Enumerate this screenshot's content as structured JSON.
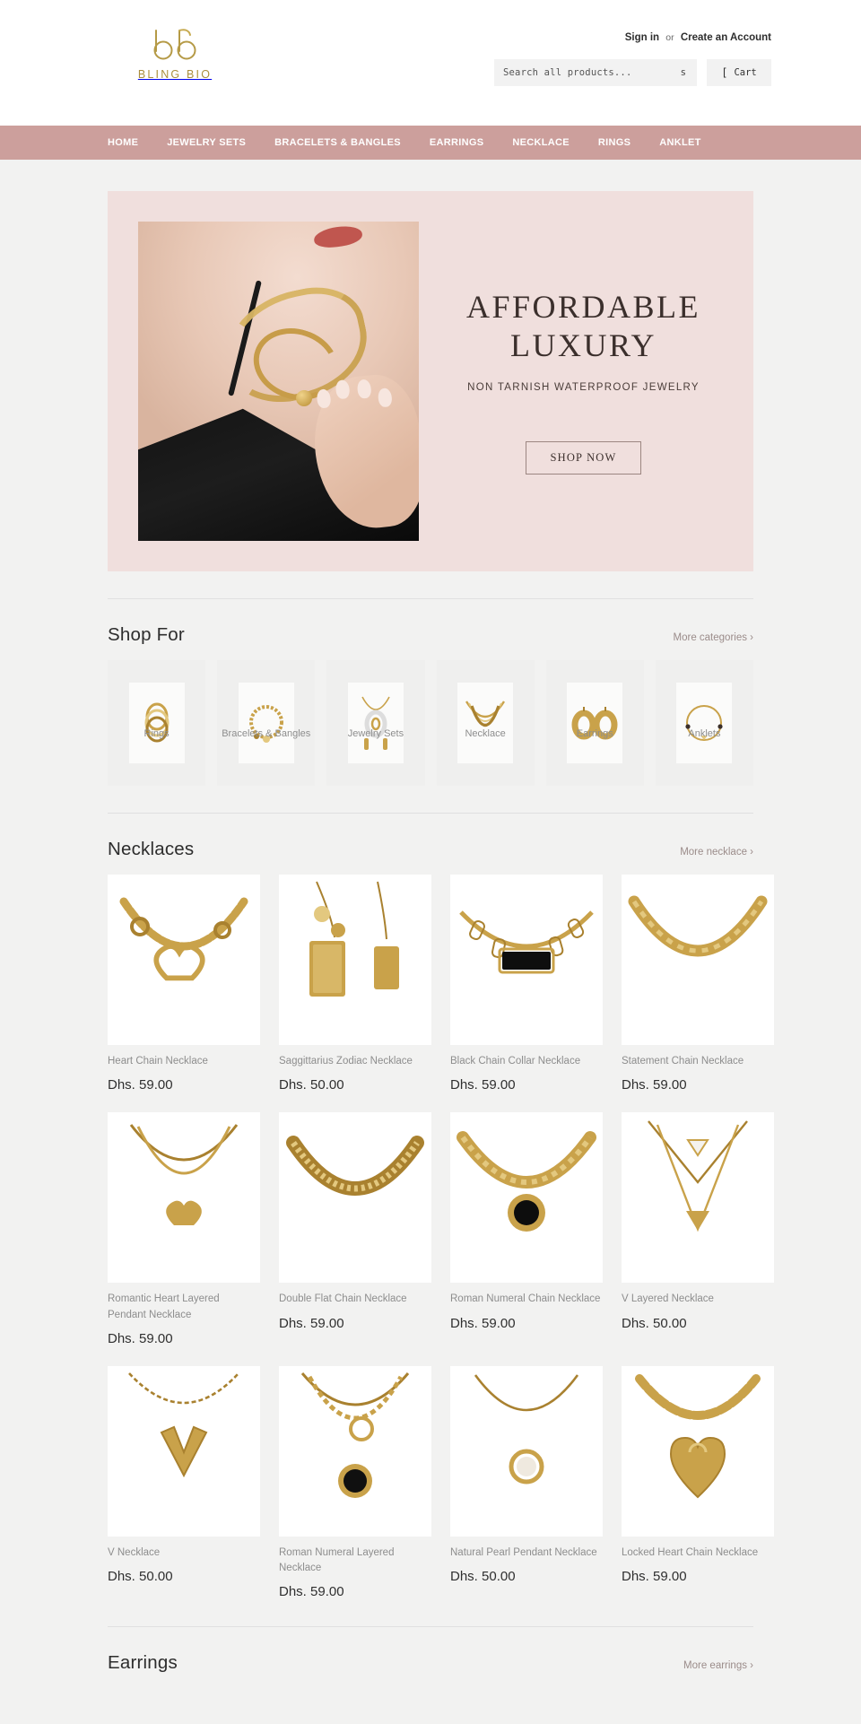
{
  "brand": {
    "name": "BLING BIO",
    "logo_mark": "bb-monogram",
    "logo_color": "#ab8f3e"
  },
  "header": {
    "sign_in": "Sign in",
    "or": "or",
    "create_account": "Create an Account",
    "search_placeholder": "Search all products...",
    "search_value": "",
    "search_submit_label": "s",
    "cart_label": "Cart",
    "cart_icon": "cart-icon"
  },
  "nav": {
    "background": "#cc9f9c",
    "items": [
      {
        "label": "HOME"
      },
      {
        "label": "JEWELRY SETS"
      },
      {
        "label": "BRACELETS & BANGLES"
      },
      {
        "label": "EARRINGS"
      },
      {
        "label": "NECKLACE"
      },
      {
        "label": "RINGS"
      },
      {
        "label": "ANKLET"
      }
    ]
  },
  "hero": {
    "background": "#f0dfdd",
    "title_line1": "AFFORDABLE",
    "title_line2": "LUXURY",
    "subtitle": "NON TARNISH WATERPROOF JEWELRY",
    "button": "SHOP NOW"
  },
  "shop_for": {
    "title": "Shop For",
    "more_label": "More categories ›",
    "categories": [
      {
        "label": "Rings",
        "icon": "rings-icon"
      },
      {
        "label": "Bracelets & Bangles",
        "icon": "bracelet-icon"
      },
      {
        "label": "Jewelry Sets",
        "icon": "jewelry-set-icon"
      },
      {
        "label": "Necklace",
        "icon": "necklace-icon"
      },
      {
        "label": "Earrings",
        "icon": "earrings-icon"
      },
      {
        "label": "Anklets",
        "icon": "anklet-icon"
      }
    ]
  },
  "necklaces": {
    "title": "Necklaces",
    "more_label": "More necklace ›",
    "products": [
      {
        "name": "Heart Chain Necklace",
        "price": "Dhs. 59.00",
        "style": "heart-toggle"
      },
      {
        "name": "Saggittarius Zodiac Necklace",
        "price": "Dhs. 50.00",
        "style": "zodiac-tags"
      },
      {
        "name": "Black Chain Collar Necklace",
        "price": "Dhs. 59.00",
        "style": "black-bar-collar"
      },
      {
        "name": "Statement Chain Necklace",
        "price": "Dhs. 59.00",
        "style": "statement-chain"
      },
      {
        "name": "Romantic Heart Layered Pendant Necklace",
        "price": "Dhs. 59.00",
        "style": "heart-layered"
      },
      {
        "name": "Double Flat Chain Necklace",
        "price": "Dhs. 59.00",
        "style": "flat-chain"
      },
      {
        "name": "Roman Numeral Chain Necklace",
        "price": "Dhs. 59.00",
        "style": "roman-disc"
      },
      {
        "name": "V Layered Necklace",
        "price": "Dhs. 50.00",
        "style": "v-layered"
      },
      {
        "name": "V Necklace",
        "price": "Dhs. 50.00",
        "style": "v-pendant"
      },
      {
        "name": "Roman Numeral Layered Necklace",
        "price": "Dhs. 59.00",
        "style": "roman-layered"
      },
      {
        "name": "Natural Pearl Pendant Necklace",
        "price": "Dhs. 50.00",
        "style": "pearl-pendant"
      },
      {
        "name": "Locked Heart Chain Necklace",
        "price": "Dhs. 59.00",
        "style": "locked-heart"
      }
    ]
  },
  "earrings": {
    "title": "Earrings",
    "more_label": "More earrings ›"
  }
}
